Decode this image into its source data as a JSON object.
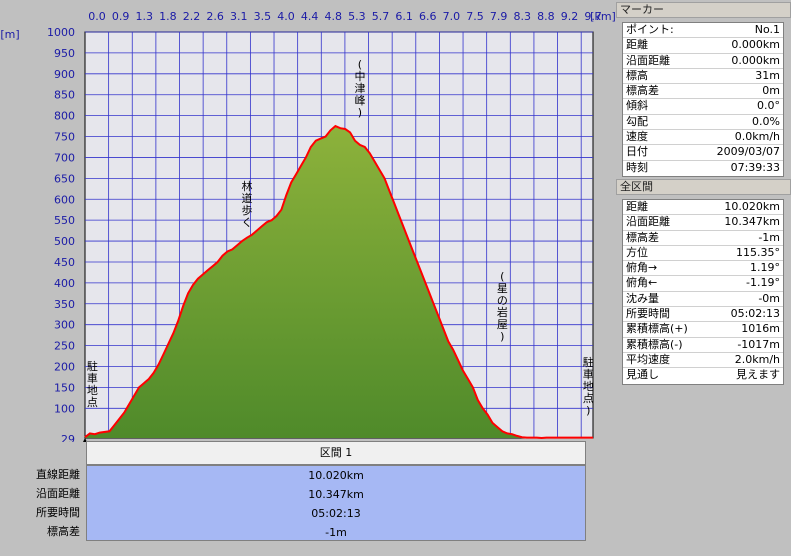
{
  "chart_data": {
    "type": "area",
    "x_unit": "[km]",
    "y_unit": "[m]",
    "x_ticks": [
      "0.0",
      "0.9",
      "1.3",
      "1.8",
      "2.2",
      "2.6",
      "3.1",
      "3.5",
      "4.0",
      "4.4",
      "4.8",
      "5.3",
      "5.7",
      "6.1",
      "6.6",
      "7.0",
      "7.5",
      "7.9",
      "8.3",
      "8.8",
      "9.2",
      "9.7"
    ],
    "y_ticks": [
      1000,
      950,
      900,
      850,
      800,
      750,
      700,
      650,
      600,
      550,
      500,
      450,
      400,
      350,
      300,
      250,
      200,
      150,
      100
    ],
    "y_min_label": "29",
    "ylim": [
      29,
      1000
    ],
    "xlim": [
      0,
      10.347
    ],
    "x": [
      0,
      0.1,
      0.2,
      0.3,
      0.5,
      0.6,
      0.7,
      0.8,
      0.9,
      1.0,
      1.1,
      1.2,
      1.3,
      1.4,
      1.5,
      1.6,
      1.7,
      1.8,
      1.9,
      2.0,
      2.1,
      2.2,
      2.3,
      2.4,
      2.5,
      2.6,
      2.7,
      2.8,
      2.9,
      3.0,
      3.1,
      3.2,
      3.3,
      3.4,
      3.5,
      3.6,
      3.7,
      3.8,
      3.9,
      4.0,
      4.1,
      4.2,
      4.3,
      4.4,
      4.5,
      4.6,
      4.7,
      4.8,
      4.9,
      5.0,
      5.1,
      5.2,
      5.3,
      5.4,
      5.5,
      5.6,
      5.7,
      5.8,
      5.9,
      6.0,
      6.1,
      6.2,
      6.3,
      6.4,
      6.5,
      6.6,
      6.7,
      6.8,
      6.9,
      7.0,
      7.1,
      7.2,
      7.3,
      7.4,
      7.5,
      7.6,
      7.7,
      7.8,
      7.9,
      8.0,
      8.1,
      8.2,
      8.3,
      8.4,
      8.5,
      8.6,
      8.7,
      8.8,
      8.9,
      9.0,
      9.1,
      9.2,
      9.3,
      9.4,
      9.5,
      9.6,
      9.7,
      9.8,
      9.9,
      10.0,
      10.1,
      10.2,
      10.347
    ],
    "y": [
      31,
      40,
      38,
      42,
      45,
      60,
      75,
      90,
      110,
      130,
      150,
      160,
      170,
      185,
      205,
      230,
      255,
      280,
      310,
      345,
      375,
      395,
      410,
      420,
      430,
      440,
      450,
      465,
      475,
      480,
      490,
      500,
      508,
      515,
      525,
      535,
      545,
      550,
      560,
      575,
      610,
      640,
      660,
      680,
      700,
      725,
      740,
      745,
      750,
      765,
      775,
      770,
      768,
      760,
      740,
      730,
      725,
      710,
      690,
      670,
      650,
      620,
      590,
      560,
      530,
      500,
      470,
      440,
      410,
      380,
      350,
      320,
      290,
      260,
      240,
      215,
      190,
      170,
      150,
      120,
      100,
      85,
      65,
      55,
      45,
      40,
      38,
      34,
      31,
      30,
      30,
      30,
      29,
      30,
      30,
      30,
      30,
      30,
      30,
      30,
      30,
      30,
      30
    ],
    "annotations": [
      {
        "text": "駐車地点",
        "x": 0.15
      },
      {
        "text": "林道歩く",
        "x": 3.3
      },
      {
        "text": "(中津峰)",
        "x": 5.6
      },
      {
        "text": "(星の岩屋)",
        "x": 8.5
      },
      {
        "text": "駐車地点)",
        "x": 10.25
      }
    ],
    "line_color": "#ff0000",
    "fill_top": "#8db23b",
    "fill_bottom": "#4f8a2a",
    "bg_color": "#e6e6ec",
    "grid_color": "#3333cc",
    "grid": true
  },
  "section": {
    "header": "区間 1",
    "rows": [
      {
        "label": "直線距離",
        "value": "10.020km"
      },
      {
        "label": "沿面距離",
        "value": "10.347km"
      },
      {
        "label": "所要時間",
        "value": "05:02:13"
      },
      {
        "label": "標高差",
        "value": "-1m"
      }
    ]
  },
  "marker": {
    "title": "マーカー",
    "rows": [
      {
        "k": "ポイント:",
        "v": "No.1"
      },
      {
        "k": "距離",
        "v": "0.000km"
      },
      {
        "k": "沿面距離",
        "v": "0.000km"
      },
      {
        "k": "標高",
        "v": "31m"
      },
      {
        "k": "標高差",
        "v": "0m"
      },
      {
        "k": "傾斜",
        "v": "0.0°"
      },
      {
        "k": "勾配",
        "v": "0.0%"
      },
      {
        "k": "速度",
        "v": "0.0km/h"
      },
      {
        "k": "日付",
        "v": "2009/03/07"
      },
      {
        "k": "時刻",
        "v": "07:39:33"
      }
    ]
  },
  "total": {
    "title": "全区間",
    "rows": [
      {
        "k": "距離",
        "v": "10.020km"
      },
      {
        "k": "沿面距離",
        "v": "10.347km"
      },
      {
        "k": "標高差",
        "v": "-1m"
      },
      {
        "k": "方位",
        "v": "115.35°"
      },
      {
        "k": "俯角→",
        "v": "1.19°"
      },
      {
        "k": "俯角←",
        "v": "-1.19°"
      },
      {
        "k": "沈み量",
        "v": "-0m"
      },
      {
        "k": "所要時間",
        "v": "05:02:13"
      },
      {
        "k": "累積標高(+)",
        "v": "1016m"
      },
      {
        "k": "累積標高(-)",
        "v": "-1017m"
      },
      {
        "k": "平均速度",
        "v": "2.0km/h"
      },
      {
        "k": "見通し",
        "v": "見えます"
      }
    ]
  }
}
